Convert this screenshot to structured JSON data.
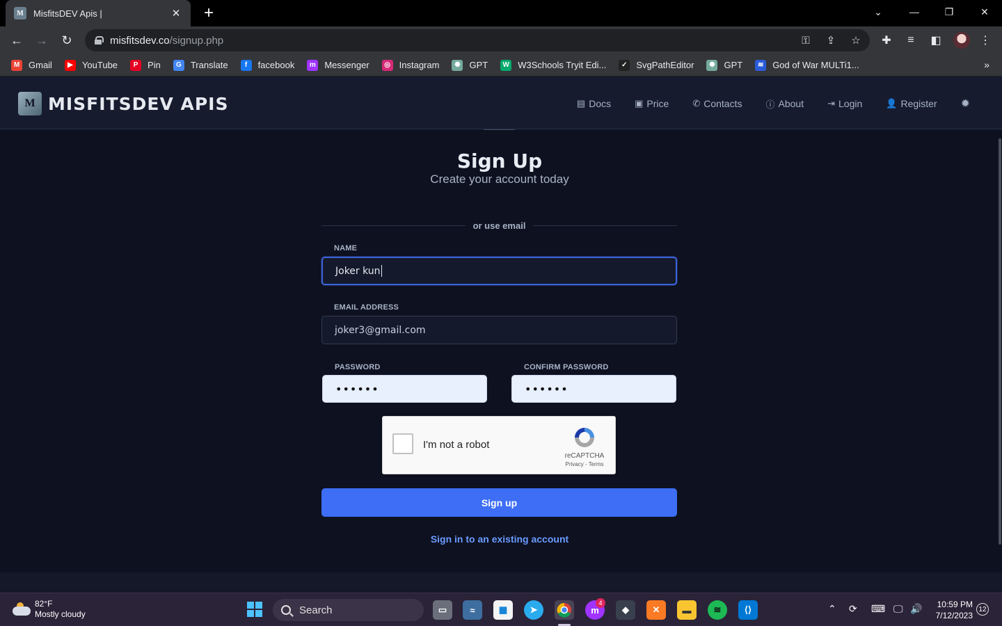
{
  "browser": {
    "tab_title": "MisfitsDEV Apis |",
    "tab_favicon": "M",
    "url_domain": "misfitsdev.co",
    "url_path": "/signup.php",
    "bookmarks": [
      {
        "label": "Gmail",
        "icon": "gmail-icon",
        "color": "#ea4335",
        "glyph": "M"
      },
      {
        "label": "YouTube",
        "icon": "youtube-icon",
        "color": "#ff0000",
        "glyph": "▶"
      },
      {
        "label": "Pin",
        "icon": "pinterest-icon",
        "color": "#e60023",
        "glyph": "P"
      },
      {
        "label": "Translate",
        "icon": "translate-icon",
        "color": "#4285f4",
        "glyph": "G"
      },
      {
        "label": "facebook",
        "icon": "facebook-icon",
        "color": "#1877f2",
        "glyph": "f"
      },
      {
        "label": "Messenger",
        "icon": "messenger-icon",
        "color": "#a033ff",
        "glyph": "m"
      },
      {
        "label": "Instagram",
        "icon": "instagram-icon",
        "color": "#d62976",
        "glyph": "◎"
      },
      {
        "label": "GPT",
        "icon": "chatgpt-icon",
        "color": "#74aa9c",
        "glyph": "✺"
      },
      {
        "label": "W3Schools Tryit Edi...",
        "icon": "w3schools-icon",
        "color": "#04aa6d",
        "glyph": "W"
      },
      {
        "label": "SvgPathEditor",
        "icon": "svgpatheditor-icon",
        "color": "#222222",
        "glyph": "✓"
      },
      {
        "label": "GPT",
        "icon": "chatgpt-icon",
        "color": "#74aa9c",
        "glyph": "✺"
      },
      {
        "label": "God of War MULTi1...",
        "icon": "torrent-icon",
        "color": "#2a5bd7",
        "glyph": "≋"
      }
    ],
    "bookmarks_more": "»"
  },
  "site": {
    "logo_text": "MISFITSDEV APIS",
    "logo_mark": "M",
    "nav": [
      {
        "label": "Docs",
        "icon": "book-icon",
        "glyph": "▤"
      },
      {
        "label": "Price",
        "icon": "money-icon",
        "glyph": "▣"
      },
      {
        "label": "Contacts",
        "icon": "phone-icon",
        "glyph": "✆"
      },
      {
        "label": "About",
        "icon": "info-icon",
        "glyph": "ⓘ"
      },
      {
        "label": "Login",
        "icon": "login-icon",
        "glyph": "⇥"
      },
      {
        "label": "Register",
        "icon": "user-plus-icon",
        "glyph": "👤"
      }
    ],
    "theme_glyph": "✹"
  },
  "form": {
    "title": "Sign Up",
    "subtitle": "Create your account today",
    "divider_text": "or use email",
    "name_label": "NAME",
    "name_value": "Joker kun",
    "email_label": "EMAIL ADDRESS",
    "email_value": "joker3@gmail.com",
    "password_label": "PASSWORD",
    "password_value": "••••••",
    "confirm_label": "CONFIRM PASSWORD",
    "confirm_value": "••••••",
    "captcha_text": "I'm not a robot",
    "captcha_brand": "reCAPTCHA",
    "captcha_links": "Privacy - Terms",
    "submit_label": "Sign up",
    "signin_link": "Sign in to an existing account"
  },
  "taskbar": {
    "temperature": "82°F",
    "weather": "Mostly cloudy",
    "search_label": "Search",
    "time": "10:59 PM",
    "date": "7/12/2023",
    "notifications": "12",
    "messenger_badge": "4"
  }
}
